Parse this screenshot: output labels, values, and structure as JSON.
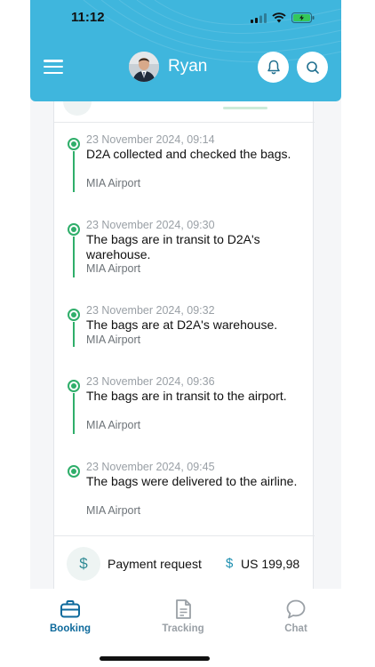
{
  "status_bar": {
    "time": "11:12",
    "icons": [
      "cellular-icon",
      "wifi-icon",
      "battery-charging-icon"
    ]
  },
  "header": {
    "user_name": "Ryan",
    "icons": [
      "menu-icon",
      "bell-icon",
      "search-icon"
    ]
  },
  "timeline": [
    {
      "date": "23 November 2024, 09:14",
      "text": "D2A collected and checked the bags.",
      "place": "MIA Airport"
    },
    {
      "date": "23 November 2024, 09:30",
      "text": "The bags are in transit to D2A's warehouse.",
      "place": "MIA Airport"
    },
    {
      "date": "23 November 2024, 09:32",
      "text": "The bags are at D2A's warehouse.",
      "place": "MIA Airport"
    },
    {
      "date": "23 November 2024, 09:36",
      "text": "The bags are in transit to the airport.",
      "place": "MIA Airport"
    },
    {
      "date": "23 November 2024, 09:45",
      "text": "The bags were delivered to the airline.",
      "place": "MIA Airport"
    }
  ],
  "payment": {
    "icon": "$",
    "label": "Payment request",
    "currency_symbol": "$",
    "amount": "US 199,98"
  },
  "bottom_nav": [
    {
      "label": "Booking",
      "icon": "briefcase-icon",
      "active": true
    },
    {
      "label": "Tracking",
      "icon": "document-icon",
      "active": false
    },
    {
      "label": "Chat",
      "icon": "chat-bubble-icon",
      "active": false
    }
  ],
  "colors": {
    "header": "#3fb6dd",
    "timeline_green": "#2fae6a",
    "active_nav": "#0e6a9c",
    "inactive_nav": "#9aa0a6"
  }
}
